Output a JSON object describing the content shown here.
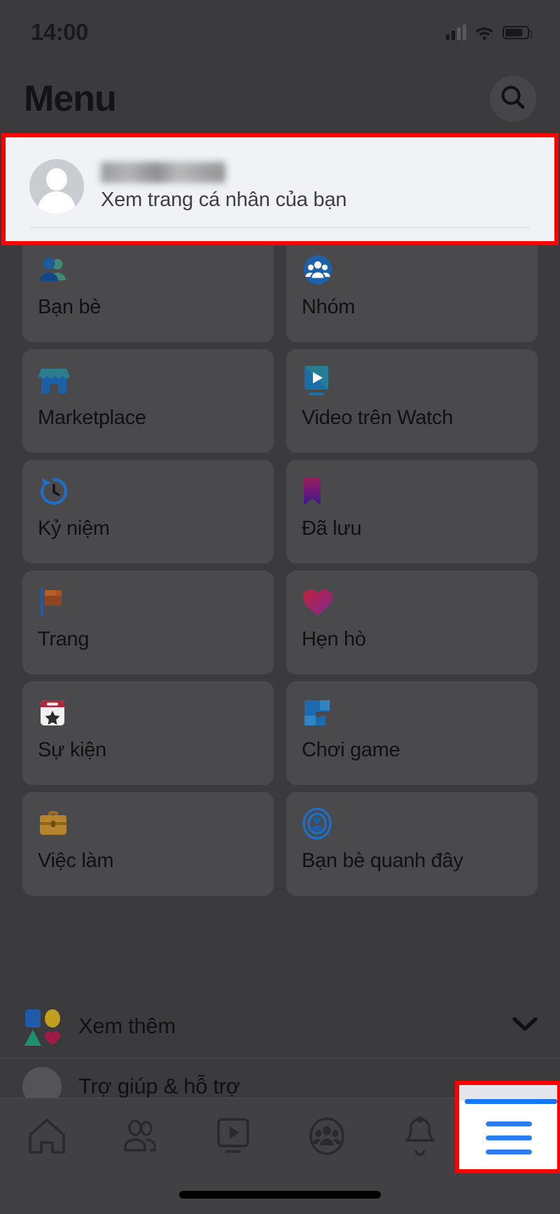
{
  "statusbar": {
    "time": "14:00",
    "icons": [
      "cellular-signal-icon",
      "wifi-icon",
      "battery-icon"
    ]
  },
  "header": {
    "title": "Menu",
    "search_icon": "search-icon"
  },
  "profile": {
    "name": "",
    "name_blurred": true,
    "subtitle": "Xem trang cá nhân của bạn",
    "avatar_icon": "default-avatar-icon",
    "highlighted": true,
    "highlight_color": "#fe0000"
  },
  "menu_grid": [
    {
      "label": "Bạn bè",
      "icon": "friends-icon"
    },
    {
      "label": "Nhóm",
      "icon": "groups-icon"
    },
    {
      "label": "Marketplace",
      "icon": "marketplace-icon"
    },
    {
      "label": "Video trên Watch",
      "icon": "watch-video-icon"
    },
    {
      "label": "Kỷ niệm",
      "icon": "memories-clock-icon"
    },
    {
      "label": "Đã lưu",
      "icon": "saved-bookmark-icon"
    },
    {
      "label": "Trang",
      "icon": "pages-flag-icon"
    },
    {
      "label": "Hẹn hò",
      "icon": "dating-heart-icon"
    },
    {
      "label": "Sự kiện",
      "icon": "events-calendar-icon"
    },
    {
      "label": "Chơi game",
      "icon": "gaming-icon"
    },
    {
      "label": "Việc làm",
      "icon": "jobs-briefcase-icon"
    },
    {
      "label": "Bạn bè quanh đây",
      "icon": "nearby-friends-icon"
    }
  ],
  "see_more": {
    "label": "Xem thêm",
    "icon": "shapes-icon",
    "chevron": "chevron-down-icon"
  },
  "partial_row": {
    "label": "Trợ giúp & hỗ trợ",
    "icon": "help-support-icon"
  },
  "bottom_nav": {
    "items": [
      {
        "name": "home-tab",
        "icon": "home-icon",
        "active": false
      },
      {
        "name": "friends-tab",
        "icon": "friends-outline-icon",
        "active": false
      },
      {
        "name": "watch-tab",
        "icon": "watch-play-icon",
        "active": false
      },
      {
        "name": "groups-tab",
        "icon": "groups-outline-icon",
        "active": false
      },
      {
        "name": "notifications-tab",
        "icon": "bell-icon",
        "active": false
      },
      {
        "name": "menu-tab",
        "icon": "hamburger-menu-icon",
        "active": true
      }
    ],
    "active_color": "#1877f2",
    "highlighted_tab": "menu-tab",
    "highlight_color": "#fe0000"
  },
  "overlay": {
    "dimmed": true,
    "dim_color": "#3b3b3d"
  }
}
